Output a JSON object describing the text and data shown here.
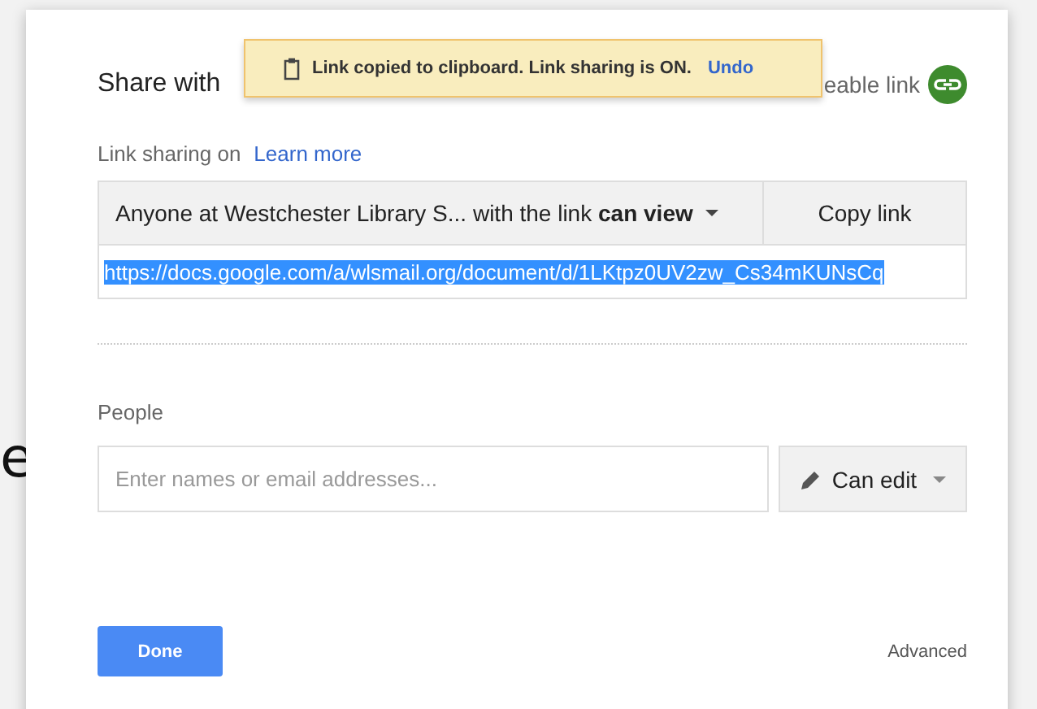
{
  "background_text": "e",
  "dialog": {
    "title": "Share with",
    "shareable_link_label": "eable link"
  },
  "toast": {
    "message": "Link copied to clipboard. Link sharing is ON.",
    "action": "Undo"
  },
  "link_sharing": {
    "label": "Link sharing on",
    "help_link": "Learn more",
    "access": "Anyone at Westchester Library S...  with the link **can view**",
    "copy_button": "Copy link",
    "url": "https://docs.google.com/a/wlsmail.org/document/d/1LKtpz0UV2zw_Cs34mKUNsCq",
    "url_selected": true
  },
  "people": {
    "label": "People",
    "placeholder": "Enter names or email addresses...",
    "permission": "Can edit"
  },
  "footer": {
    "done": "Done",
    "advanced": "Advanced"
  }
}
